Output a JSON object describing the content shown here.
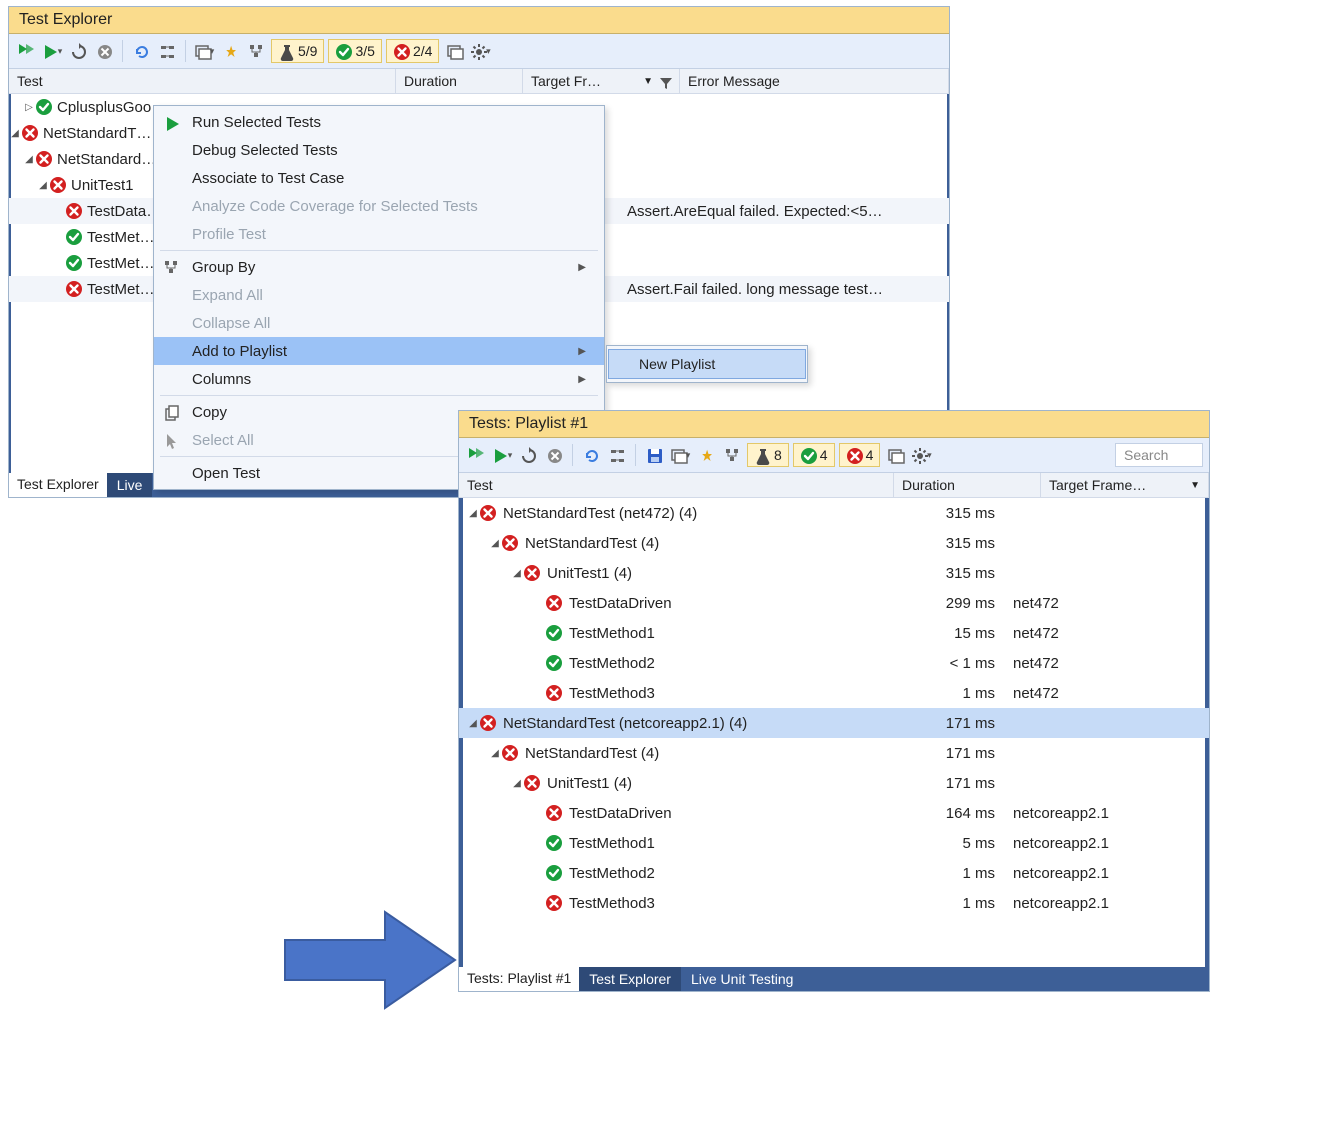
{
  "panel1": {
    "title": "Test Explorer",
    "counters": {
      "flask": "5/9",
      "pass": "3/5",
      "fail": "2/4"
    },
    "columns": {
      "test": "Test",
      "duration": "Duration",
      "target": "Target Fr…",
      "error": "Error Message"
    },
    "tree": {
      "r0": "CplusplusGoo…",
      "r1": "NetStandardT…",
      "r2": "NetStandard…",
      "r3": "UnitTest1",
      "r4": "TestData…",
      "r5": "TestMet…",
      "r6": "TestMet…",
      "r7": "TestMet…"
    },
    "errors": {
      "e4": "Assert.AreEqual failed. Expected:<5…",
      "e7": "Assert.Fail failed. long message test…"
    },
    "status": {
      "tab1": "Test Explorer",
      "tab2": "Live"
    }
  },
  "context_menu": {
    "run": "Run Selected Tests",
    "debug": "Debug Selected Tests",
    "associate": "Associate to Test Case",
    "analyze": "Analyze Code Coverage for Selected Tests",
    "profile": "Profile Test",
    "groupby": "Group By",
    "expand": "Expand All",
    "collapse": "Collapse All",
    "addplaylist": "Add to Playlist",
    "columns": "Columns",
    "copy": "Copy",
    "selectall": "Select All",
    "opentest": "Open Test",
    "submenu_new": "New Playlist"
  },
  "panel2": {
    "title": "Tests: Playlist #1",
    "counters": {
      "flask": "8",
      "pass": "4",
      "fail": "4"
    },
    "search_placeholder": "Search",
    "columns": {
      "test": "Test",
      "duration": "Duration",
      "target": "Target Frame…"
    },
    "rows": [
      {
        "indent": 0,
        "status": "fail",
        "exp": true,
        "name": "NetStandardTest (net472)  (4)",
        "dur": "315 ms",
        "tgt": "",
        "sel": false
      },
      {
        "indent": 1,
        "status": "fail",
        "exp": true,
        "name": "NetStandardTest  (4)",
        "dur": "315 ms",
        "tgt": "",
        "sel": false
      },
      {
        "indent": 2,
        "status": "fail",
        "exp": true,
        "name": "UnitTest1  (4)",
        "dur": "315 ms",
        "tgt": "",
        "sel": false
      },
      {
        "indent": 3,
        "status": "fail",
        "exp": false,
        "name": "TestDataDriven",
        "dur": "299 ms",
        "tgt": "net472",
        "sel": false
      },
      {
        "indent": 3,
        "status": "pass",
        "exp": false,
        "name": "TestMethod1",
        "dur": "15 ms",
        "tgt": "net472",
        "sel": false
      },
      {
        "indent": 3,
        "status": "pass",
        "exp": false,
        "name": "TestMethod2",
        "dur": "< 1 ms",
        "tgt": "net472",
        "sel": false
      },
      {
        "indent": 3,
        "status": "fail",
        "exp": false,
        "name": "TestMethod3",
        "dur": "1 ms",
        "tgt": "net472",
        "sel": false
      },
      {
        "indent": 0,
        "status": "fail",
        "exp": true,
        "name": "NetStandardTest (netcoreapp2.1)  (4)",
        "dur": "171 ms",
        "tgt": "",
        "sel": true
      },
      {
        "indent": 1,
        "status": "fail",
        "exp": true,
        "name": "NetStandardTest  (4)",
        "dur": "171 ms",
        "tgt": "",
        "sel": false
      },
      {
        "indent": 2,
        "status": "fail",
        "exp": true,
        "name": "UnitTest1  (4)",
        "dur": "171 ms",
        "tgt": "",
        "sel": false
      },
      {
        "indent": 3,
        "status": "fail",
        "exp": false,
        "name": "TestDataDriven",
        "dur": "164 ms",
        "tgt": "netcoreapp2.1",
        "sel": false
      },
      {
        "indent": 3,
        "status": "pass",
        "exp": false,
        "name": "TestMethod1",
        "dur": "5 ms",
        "tgt": "netcoreapp2.1",
        "sel": false
      },
      {
        "indent": 3,
        "status": "pass",
        "exp": false,
        "name": "TestMethod2",
        "dur": "1 ms",
        "tgt": "netcoreapp2.1",
        "sel": false
      },
      {
        "indent": 3,
        "status": "fail",
        "exp": false,
        "name": "TestMethod3",
        "dur": "1 ms",
        "tgt": "netcoreapp2.1",
        "sel": false
      }
    ],
    "status": {
      "label": "Tests: Playlist #1",
      "tab_te": "Test Explorer",
      "tab_lut": "Live Unit Testing"
    }
  }
}
